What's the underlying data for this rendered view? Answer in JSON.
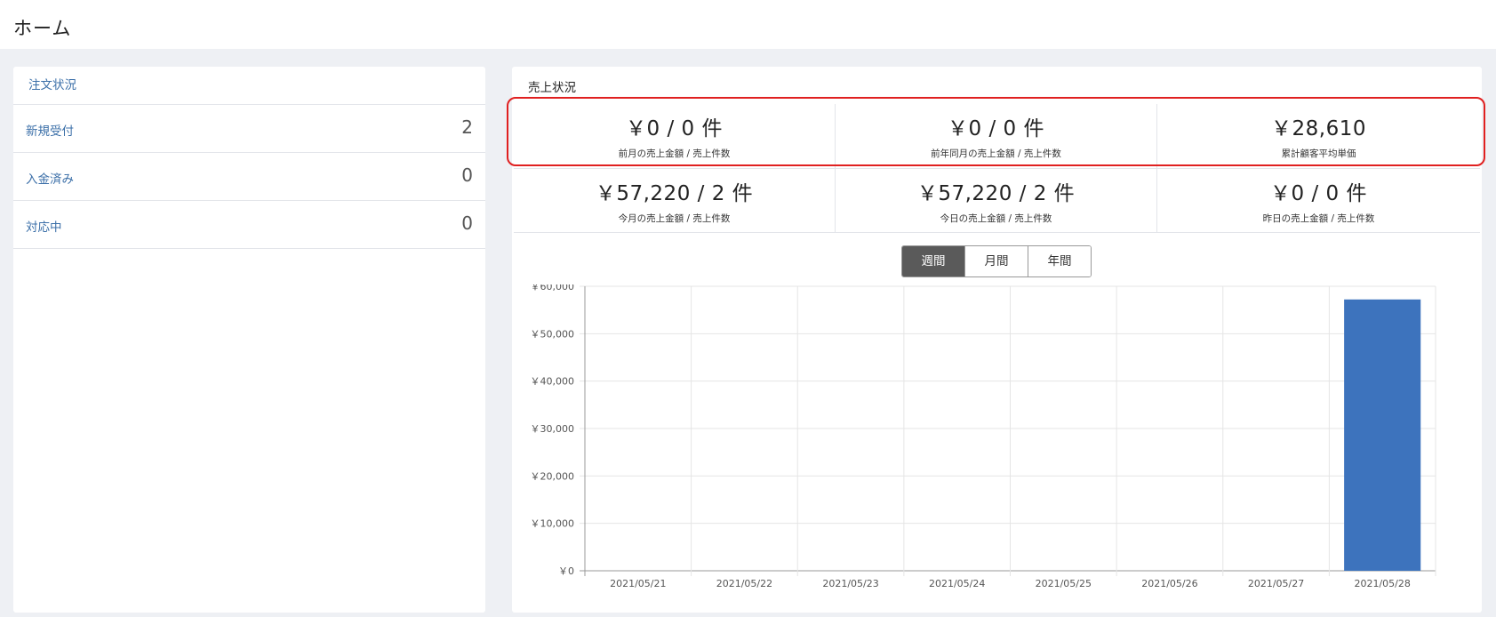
{
  "header": {
    "title": "ホーム"
  },
  "orders": {
    "title": "注文状況",
    "rows": [
      {
        "label": "新規受付",
        "count": "2"
      },
      {
        "label": "入金済み",
        "count": "0"
      },
      {
        "label": "対応中",
        "count": "0"
      }
    ]
  },
  "sales": {
    "title": "売上状況",
    "stats": [
      {
        "value": "￥0 / 0 件",
        "label": "前月の売上金額 / 売上件数"
      },
      {
        "value": "￥0 / 0 件",
        "label": "前年同月の売上金額 / 売上件数"
      },
      {
        "value": "￥28,610",
        "label": "累計顧客平均単価"
      },
      {
        "value": "￥57,220 / 2 件",
        "label": "今月の売上金額 / 売上件数"
      },
      {
        "value": "￥57,220 / 2 件",
        "label": "今日の売上金額 / 売上件数"
      },
      {
        "value": "￥0 / 0 件",
        "label": "昨日の売上金額 / 売上件数"
      }
    ],
    "period_buttons": [
      "週間",
      "月間",
      "年間"
    ],
    "active_period": "週間"
  },
  "colors": {
    "bar": "#3d73bd",
    "highlight": "#e02020",
    "active_button": "#5a5a5a",
    "link": "#3b6fa8"
  },
  "chart_data": {
    "type": "bar",
    "categories": [
      "2021/05/21",
      "2021/05/22",
      "2021/05/23",
      "2021/05/24",
      "2021/05/25",
      "2021/05/26",
      "2021/05/27",
      "2021/05/28"
    ],
    "values": [
      0,
      0,
      0,
      0,
      0,
      0,
      0,
      57220
    ],
    "ylim": [
      0,
      60000
    ],
    "yticks": [
      0,
      10000,
      20000,
      30000,
      40000,
      50000,
      60000
    ],
    "ytick_labels": [
      "￥0",
      "￥10,000",
      "￥20,000",
      "￥30,000",
      "￥40,000",
      "￥50,000",
      "￥60,000"
    ],
    "grid": true,
    "legend": "none"
  }
}
